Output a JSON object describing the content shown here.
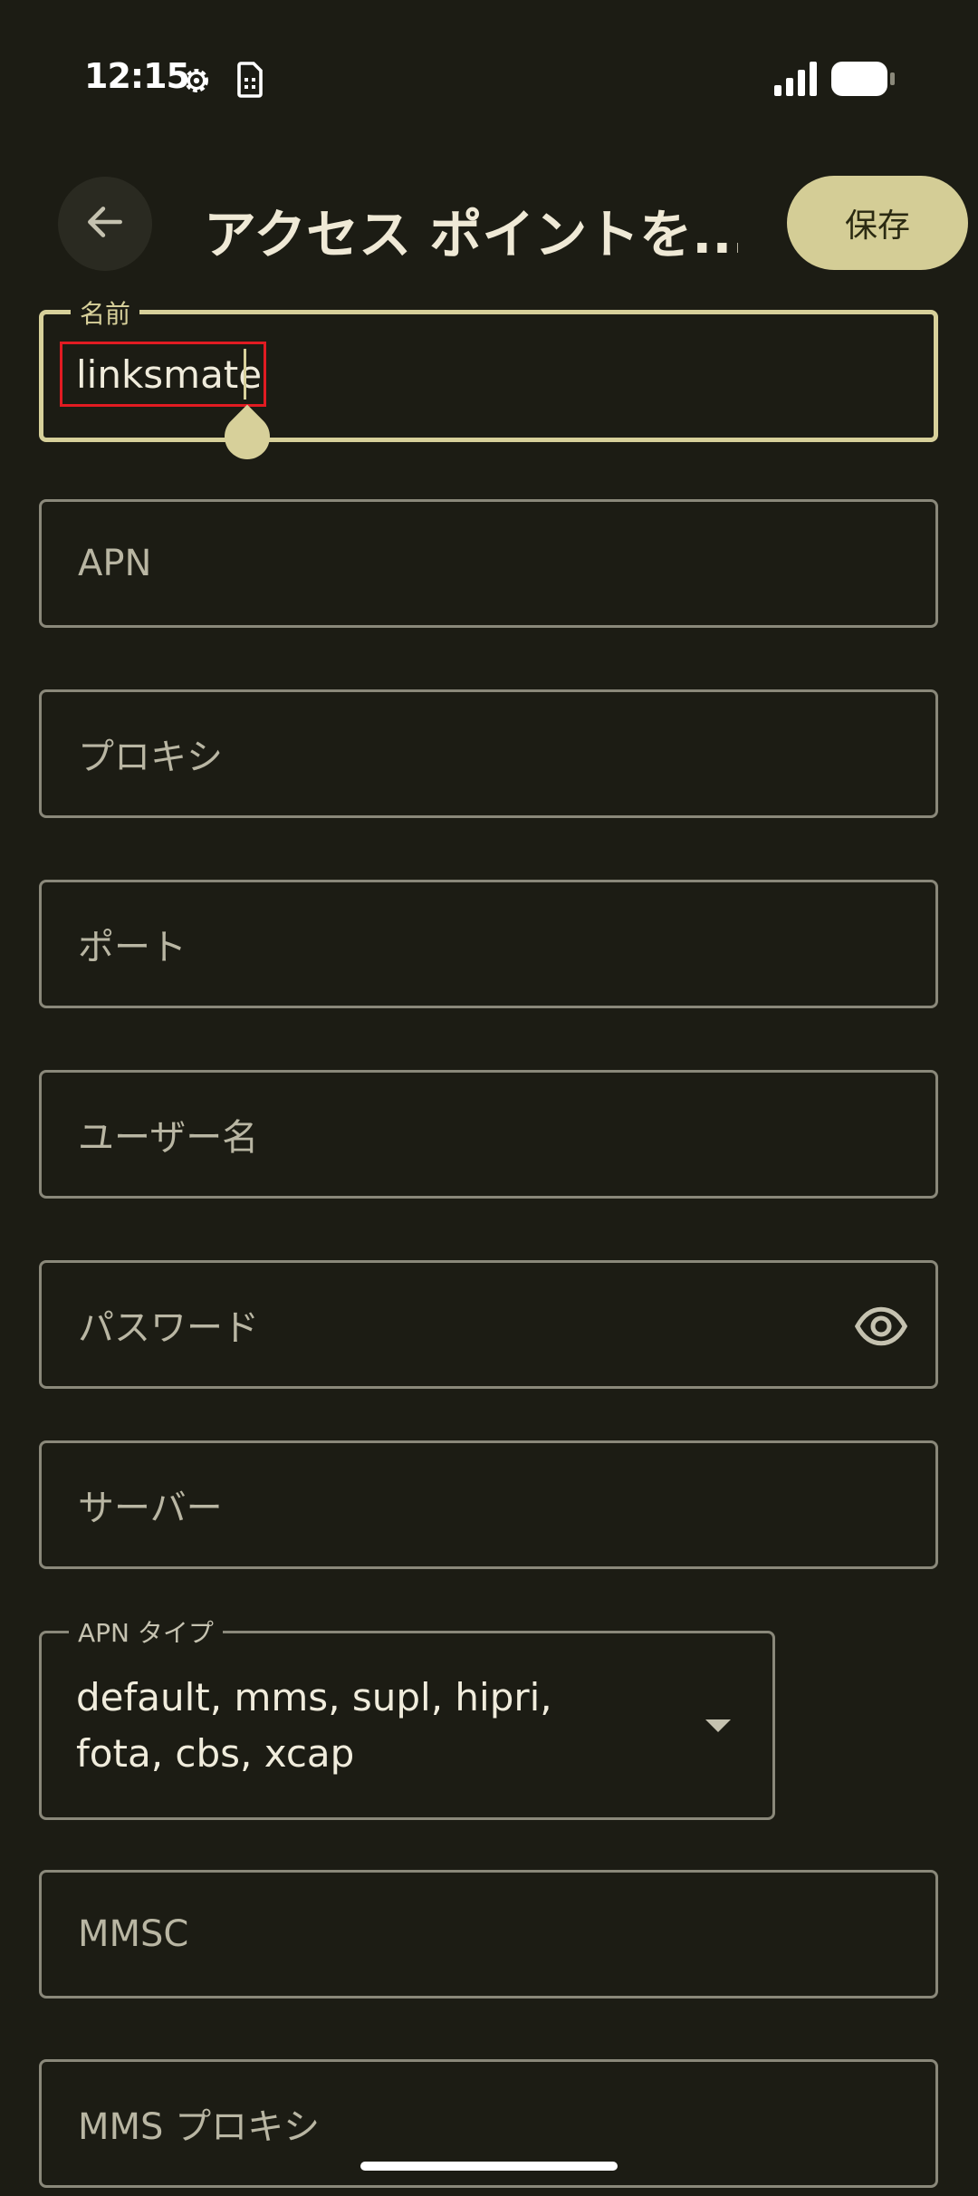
{
  "status_bar": {
    "time": "12:15",
    "icons": [
      "gear-icon",
      "sim-card-icon",
      "signal-icon",
      "battery-icon"
    ]
  },
  "top_bar": {
    "back_icon": "arrow-left-icon",
    "title": "アクセス ポイントを...",
    "save_label": "保存"
  },
  "fields": {
    "name": {
      "label": "名前",
      "value": "linksmate"
    },
    "apn": {
      "placeholder": "APN"
    },
    "proxy": {
      "placeholder": "プロキシ"
    },
    "port": {
      "placeholder": "ポート"
    },
    "username": {
      "placeholder": "ユーザー名"
    },
    "password": {
      "placeholder": "パスワード",
      "icon": "eye-icon"
    },
    "server": {
      "placeholder": "サーバー"
    },
    "apn_type": {
      "label": "APN タイプ",
      "value": "default, mms, supl, hipri, fota, cbs, xcap"
    },
    "mmsc": {
      "placeholder": "MMSC"
    },
    "mms_proxy": {
      "placeholder": "MMS プロキシ"
    }
  },
  "colors": {
    "background": "#1c1c14",
    "accent": "#d7d09a",
    "highlight": "#e11b22"
  }
}
